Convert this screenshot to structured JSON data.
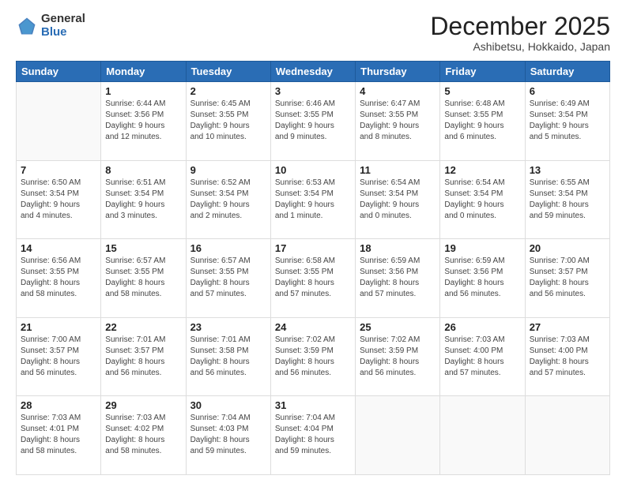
{
  "header": {
    "logo_general": "General",
    "logo_blue": "Blue",
    "title": "December 2025",
    "subtitle": "Ashibetsu, Hokkaido, Japan"
  },
  "weekdays": [
    "Sunday",
    "Monday",
    "Tuesday",
    "Wednesday",
    "Thursday",
    "Friday",
    "Saturday"
  ],
  "weeks": [
    [
      {
        "day": null,
        "info": null
      },
      {
        "day": "1",
        "info": "Sunrise: 6:44 AM\nSunset: 3:56 PM\nDaylight: 9 hours\nand 12 minutes."
      },
      {
        "day": "2",
        "info": "Sunrise: 6:45 AM\nSunset: 3:55 PM\nDaylight: 9 hours\nand 10 minutes."
      },
      {
        "day": "3",
        "info": "Sunrise: 6:46 AM\nSunset: 3:55 PM\nDaylight: 9 hours\nand 9 minutes."
      },
      {
        "day": "4",
        "info": "Sunrise: 6:47 AM\nSunset: 3:55 PM\nDaylight: 9 hours\nand 8 minutes."
      },
      {
        "day": "5",
        "info": "Sunrise: 6:48 AM\nSunset: 3:55 PM\nDaylight: 9 hours\nand 6 minutes."
      },
      {
        "day": "6",
        "info": "Sunrise: 6:49 AM\nSunset: 3:54 PM\nDaylight: 9 hours\nand 5 minutes."
      }
    ],
    [
      {
        "day": "7",
        "info": "Sunrise: 6:50 AM\nSunset: 3:54 PM\nDaylight: 9 hours\nand 4 minutes."
      },
      {
        "day": "8",
        "info": "Sunrise: 6:51 AM\nSunset: 3:54 PM\nDaylight: 9 hours\nand 3 minutes."
      },
      {
        "day": "9",
        "info": "Sunrise: 6:52 AM\nSunset: 3:54 PM\nDaylight: 9 hours\nand 2 minutes."
      },
      {
        "day": "10",
        "info": "Sunrise: 6:53 AM\nSunset: 3:54 PM\nDaylight: 9 hours\nand 1 minute."
      },
      {
        "day": "11",
        "info": "Sunrise: 6:54 AM\nSunset: 3:54 PM\nDaylight: 9 hours\nand 0 minutes."
      },
      {
        "day": "12",
        "info": "Sunrise: 6:54 AM\nSunset: 3:54 PM\nDaylight: 9 hours\nand 0 minutes."
      },
      {
        "day": "13",
        "info": "Sunrise: 6:55 AM\nSunset: 3:54 PM\nDaylight: 8 hours\nand 59 minutes."
      }
    ],
    [
      {
        "day": "14",
        "info": "Sunrise: 6:56 AM\nSunset: 3:55 PM\nDaylight: 8 hours\nand 58 minutes."
      },
      {
        "day": "15",
        "info": "Sunrise: 6:57 AM\nSunset: 3:55 PM\nDaylight: 8 hours\nand 58 minutes."
      },
      {
        "day": "16",
        "info": "Sunrise: 6:57 AM\nSunset: 3:55 PM\nDaylight: 8 hours\nand 57 minutes."
      },
      {
        "day": "17",
        "info": "Sunrise: 6:58 AM\nSunset: 3:55 PM\nDaylight: 8 hours\nand 57 minutes."
      },
      {
        "day": "18",
        "info": "Sunrise: 6:59 AM\nSunset: 3:56 PM\nDaylight: 8 hours\nand 57 minutes."
      },
      {
        "day": "19",
        "info": "Sunrise: 6:59 AM\nSunset: 3:56 PM\nDaylight: 8 hours\nand 56 minutes."
      },
      {
        "day": "20",
        "info": "Sunrise: 7:00 AM\nSunset: 3:57 PM\nDaylight: 8 hours\nand 56 minutes."
      }
    ],
    [
      {
        "day": "21",
        "info": "Sunrise: 7:00 AM\nSunset: 3:57 PM\nDaylight: 8 hours\nand 56 minutes."
      },
      {
        "day": "22",
        "info": "Sunrise: 7:01 AM\nSunset: 3:57 PM\nDaylight: 8 hours\nand 56 minutes."
      },
      {
        "day": "23",
        "info": "Sunrise: 7:01 AM\nSunset: 3:58 PM\nDaylight: 8 hours\nand 56 minutes."
      },
      {
        "day": "24",
        "info": "Sunrise: 7:02 AM\nSunset: 3:59 PM\nDaylight: 8 hours\nand 56 minutes."
      },
      {
        "day": "25",
        "info": "Sunrise: 7:02 AM\nSunset: 3:59 PM\nDaylight: 8 hours\nand 56 minutes."
      },
      {
        "day": "26",
        "info": "Sunrise: 7:03 AM\nSunset: 4:00 PM\nDaylight: 8 hours\nand 57 minutes."
      },
      {
        "day": "27",
        "info": "Sunrise: 7:03 AM\nSunset: 4:00 PM\nDaylight: 8 hours\nand 57 minutes."
      }
    ],
    [
      {
        "day": "28",
        "info": "Sunrise: 7:03 AM\nSunset: 4:01 PM\nDaylight: 8 hours\nand 58 minutes."
      },
      {
        "day": "29",
        "info": "Sunrise: 7:03 AM\nSunset: 4:02 PM\nDaylight: 8 hours\nand 58 minutes."
      },
      {
        "day": "30",
        "info": "Sunrise: 7:04 AM\nSunset: 4:03 PM\nDaylight: 8 hours\nand 59 minutes."
      },
      {
        "day": "31",
        "info": "Sunrise: 7:04 AM\nSunset: 4:04 PM\nDaylight: 8 hours\nand 59 minutes."
      },
      {
        "day": null,
        "info": null
      },
      {
        "day": null,
        "info": null
      },
      {
        "day": null,
        "info": null
      }
    ]
  ]
}
